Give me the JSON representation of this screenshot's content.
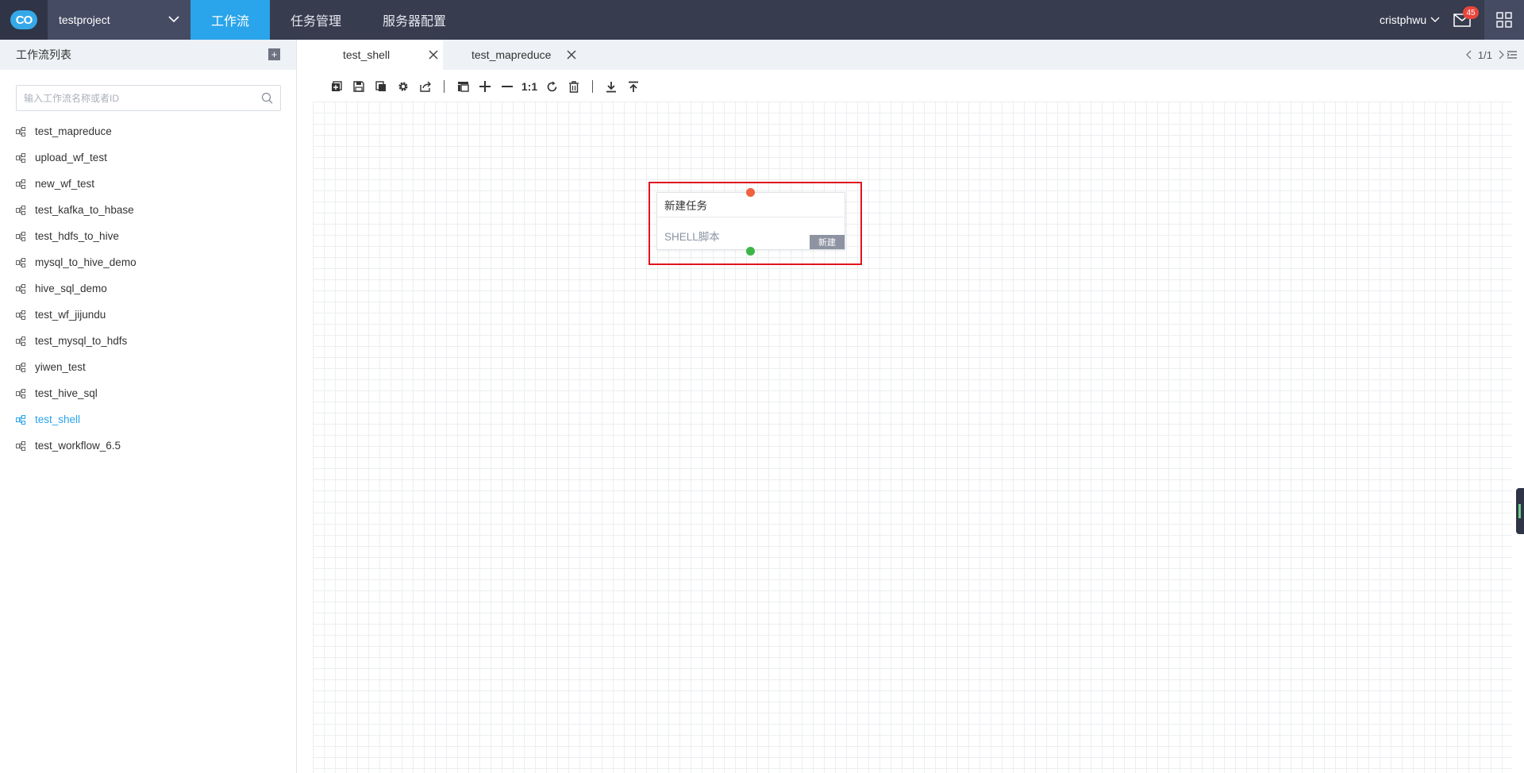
{
  "topbar": {
    "logo_text": "CO",
    "project": "testproject",
    "nav": [
      {
        "label": "工作流",
        "active": true
      },
      {
        "label": "任务管理",
        "active": false
      },
      {
        "label": "服务器配置",
        "active": false
      }
    ],
    "user": "cristphwu",
    "mail_count": "45",
    "accent_color": "#2aa4ea",
    "bg_color": "#373c4f"
  },
  "sidebar": {
    "title": "工作流列表",
    "add_icon": "+",
    "search_placeholder": "输入工作流名称或者ID",
    "items": [
      {
        "label": "test_mapreduce"
      },
      {
        "label": "upload_wf_test"
      },
      {
        "label": "new_wf_test"
      },
      {
        "label": "test_kafka_to_hbase"
      },
      {
        "label": "test_hdfs_to_hive"
      },
      {
        "label": "mysql_to_hive_demo"
      },
      {
        "label": "hive_sql_demo"
      },
      {
        "label": "test_wf_jijundu"
      },
      {
        "label": "test_mysql_to_hdfs"
      },
      {
        "label": "yiwen_test"
      },
      {
        "label": "test_hive_sql"
      },
      {
        "label": "test_shell",
        "active": true
      },
      {
        "label": "test_workflow_6.5"
      }
    ]
  },
  "tabs": [
    {
      "label": "test_shell",
      "active": true
    },
    {
      "label": "test_mapreduce",
      "active": false
    }
  ],
  "pager": {
    "text": "1/1"
  },
  "toolbar": {
    "zoom_reset_label": "1:1",
    "buttons": [
      "new-icon",
      "save-icon",
      "copy-icon",
      "settings-icon",
      "export-icon",
      "layout-icon",
      "zoom-in-icon",
      "zoom-out-icon",
      "zoom-reset",
      "refresh-icon",
      "delete-icon",
      "download-icon",
      "upload-icon"
    ]
  },
  "node": {
    "title": "新建任务",
    "type": "SHELL脚本",
    "status": "新建",
    "in_port_color": "#f2603f",
    "out_port_color": "#3cb648",
    "highlight_color": "#e0141e"
  }
}
